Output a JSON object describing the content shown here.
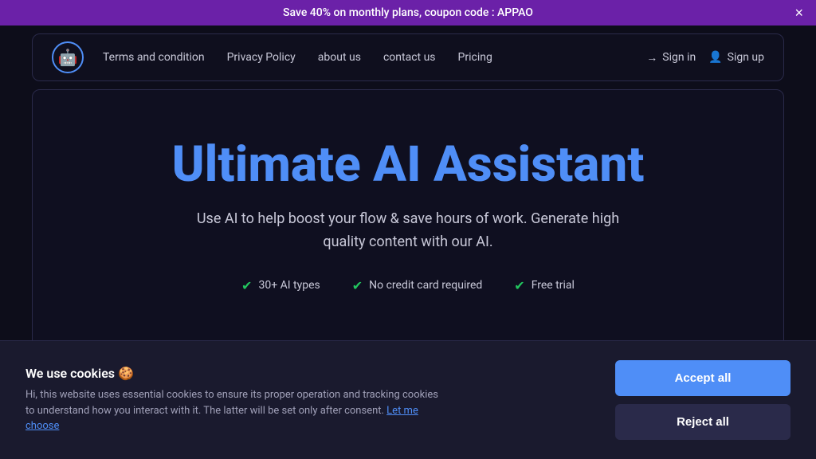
{
  "banner": {
    "text": "Save 40% on monthly plans, coupon code : APPAO",
    "close_label": "×"
  },
  "nav": {
    "logo_icon": "🤖",
    "links": [
      {
        "label": "Terms and condition",
        "id": "terms"
      },
      {
        "label": "Privacy Policy",
        "id": "privacy"
      },
      {
        "label": "about us",
        "id": "about"
      },
      {
        "label": "contact us",
        "id": "contact"
      },
      {
        "label": "Pricing",
        "id": "pricing"
      }
    ],
    "sign_in_label": "Sign in",
    "sign_up_label": "Sign up"
  },
  "hero": {
    "title": "Ultimate AI Assistant",
    "subtitle": "Use AI to help boost your flow & save hours of work. Generate high quality content with our AI.",
    "features": [
      {
        "label": "30+ AI types"
      },
      {
        "label": "No credit card required"
      },
      {
        "label": "Free trial"
      }
    ]
  },
  "cookie": {
    "title": "We use cookies 🍪",
    "description": "Hi, this website uses essential cookies to ensure its proper operation and tracking cookies to understand how you interact with it. The latter will be set only after consent.",
    "link_text": "Let me choose",
    "accept_label": "Accept all",
    "reject_label": "Reject all"
  }
}
